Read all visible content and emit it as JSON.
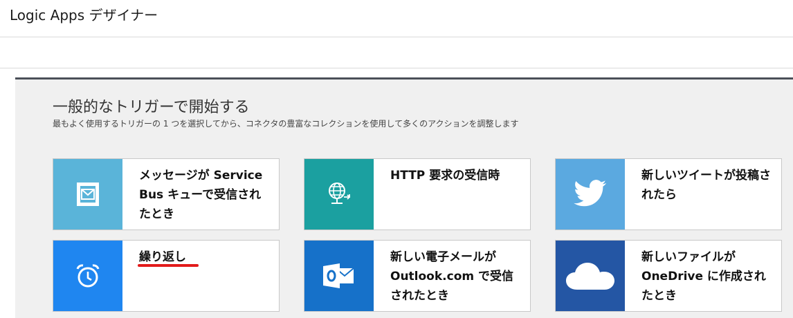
{
  "app": {
    "title": "Logic Apps デザイナー"
  },
  "gallery": {
    "heading": "一般的なトリガーで開始する",
    "subheading": "最もよく使用するトリガーの 1 つを選択してから、コネクタの豊富なコレクションを使用して多くのアクションを調整します",
    "cards": [
      {
        "label": "メッセージが Service Bus キューで受信されたとき",
        "icon": "envelope-queue-icon",
        "color": "#5ab4d9"
      },
      {
        "label": "HTTP 要求の受信時",
        "icon": "globe-request-icon",
        "color": "#1ba0a0"
      },
      {
        "label": "新しいツイートが投稿されたら",
        "icon": "twitter-bird-icon",
        "color": "#5ba9e0"
      },
      {
        "label": "繰り返し",
        "icon": "alarm-clock-icon",
        "color": "#1f86f0"
      },
      {
        "label": "新しい電子メールが Outlook.com で受信されたとき",
        "icon": "outlook-icon",
        "color": "#1671c9"
      },
      {
        "label": "新しいファイルが OneDrive に作成されたとき",
        "icon": "onedrive-cloud-icon",
        "color": "#2456a4"
      }
    ]
  }
}
